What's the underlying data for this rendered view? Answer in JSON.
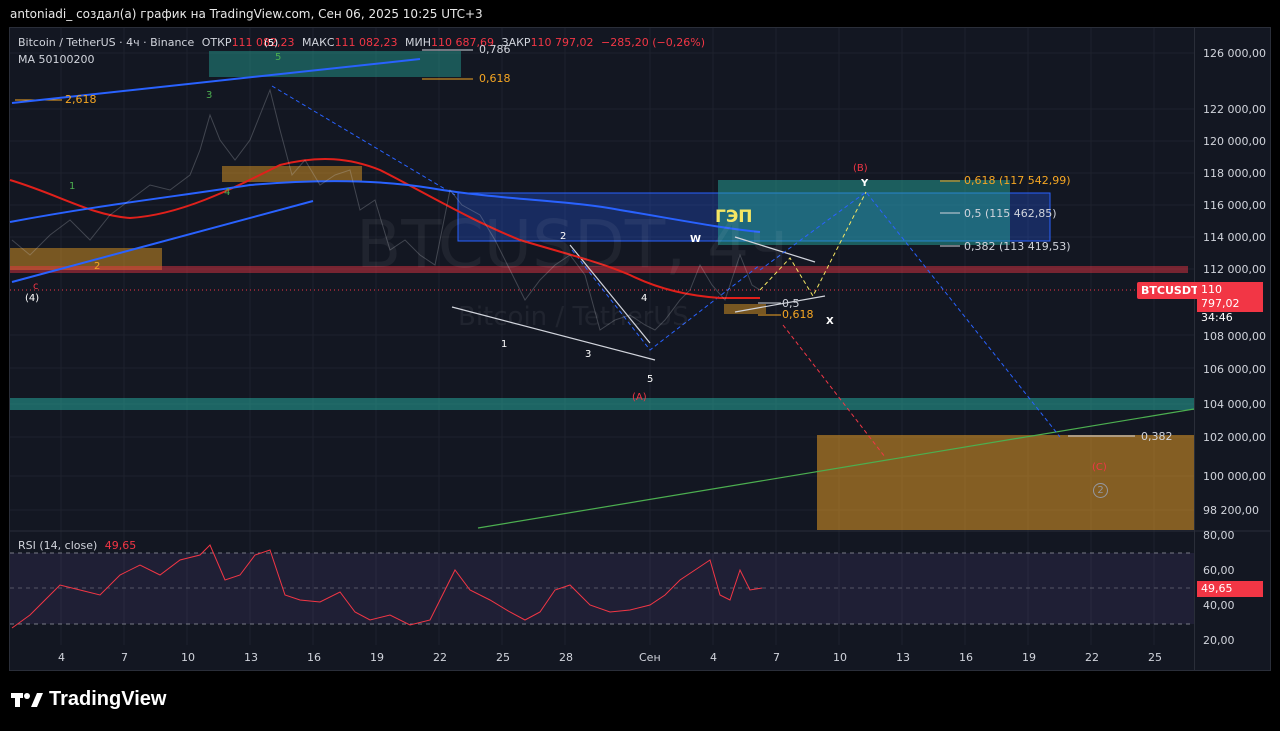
{
  "header": {
    "attribution": "antoniadi_ создал(а) график на TradingView.com, Сен 06, 2025 10:25 UTC+3"
  },
  "legend": {
    "symbol": "Bitcoin / TetherUS · 4ч · Binance",
    "open_label": "ОТКР",
    "open_value": "111 082,23",
    "high_label": "МАКС",
    "high_value": "111 082,23",
    "low_label": "МИН",
    "low_value": "110 687,69",
    "close_label": "ЗАКР",
    "close_value": "110 797,02",
    "change": "−285,20 (−0,26%)",
    "ma": "MA 50100200"
  },
  "watermark": {
    "ticker": "BTCUSDT, 4ч",
    "name": "Bitcoin / TetherUS"
  },
  "price_axis": {
    "labels": [
      "126 000,00",
      "122 000,00",
      "120 000,00",
      "118 000,00",
      "116 000,00",
      "114 000,00",
      "112 000,00",
      "108 000,00",
      "106 000,00",
      "104 000,00",
      "102 000,00",
      "100 000,00",
      "98 200,00"
    ],
    "badge_symbol": "BTCUSDT",
    "last_price": "110 797,02",
    "countdown": "34:46"
  },
  "rsi": {
    "name": "RSI (14, close)",
    "value": "49,65",
    "axis_labels": [
      "80,00",
      "60,00",
      "40,00",
      "20,00"
    ]
  },
  "time_axis": {
    "labels": [
      "4",
      "7",
      "10",
      "13",
      "16",
      "19",
      "22",
      "25",
      "28",
      "Сен",
      "4",
      "7",
      "10",
      "13",
      "16",
      "19",
      "22",
      "25"
    ]
  },
  "annotations": {
    "fib_top_0786": "0,786",
    "fib_top_0618": "0,618",
    "fib_2618": "2,618",
    "fib_0618_target": "0,618 (117 542,99)",
    "fib_05_target": "0,5 (115 462,85)",
    "fib_0382_target": "0,382 (113 419,53)",
    "fib_05_small": "0,5",
    "fib_0618_small": "0,618",
    "fib_0382_bottom": "0,382",
    "gap_label": "ГЭП",
    "wave_5_top": "(5)",
    "wave_4_left": "(4)",
    "wave_c_left": "c",
    "wave_a": "(A)",
    "wave_b": "(B)",
    "wave_c": "(C)",
    "wave_2_circle": "2",
    "w": "W",
    "x": "X",
    "y": "Y",
    "small_waves": [
      "1",
      "2",
      "3",
      "4",
      "5",
      "1",
      "2",
      "3",
      "4",
      "5"
    ]
  },
  "branding": {
    "logo_text": "TradingView"
  },
  "colors": {
    "up": "#26a69a",
    "down": "#f23645",
    "ma_red": "#e0201b",
    "ma_blue": "#2962ff",
    "orange": "#f5a623",
    "teal_box": "#26a69a"
  }
}
